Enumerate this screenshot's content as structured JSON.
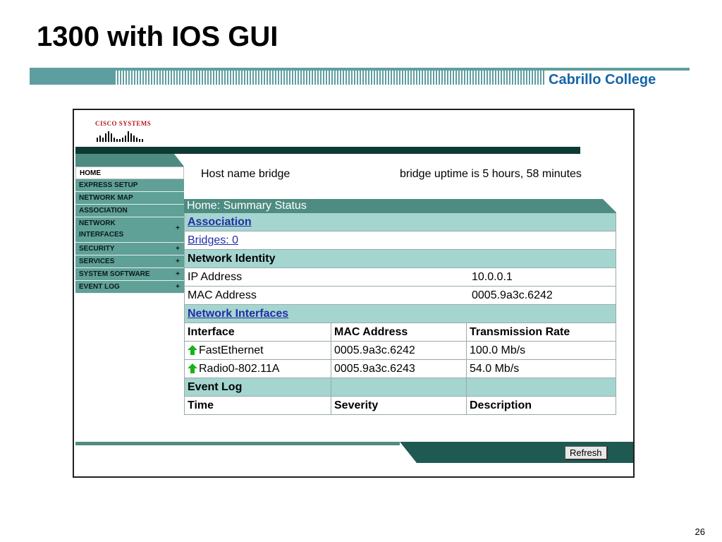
{
  "slide": {
    "title": "1300 with IOS GUI",
    "banner_text": "Cabrillo College",
    "page_number": "26"
  },
  "logo": {
    "text": "Cisco Systems"
  },
  "sidebar": {
    "items": [
      {
        "label": "HOME",
        "plus": ""
      },
      {
        "label": "EXPRESS SETUP",
        "plus": ""
      },
      {
        "label": "NETWORK MAP",
        "plus": ""
      },
      {
        "label": "ASSOCIATION",
        "plus": ""
      },
      {
        "label": "NETWORK",
        "label2": "INTERFACES",
        "plus": "+"
      },
      {
        "label": "SECURITY",
        "plus": "+"
      },
      {
        "label": "SERVICES",
        "plus": "+"
      },
      {
        "label": "SYSTEM SOFTWARE",
        "plus": "+"
      },
      {
        "label": "EVENT LOG",
        "plus": "+"
      }
    ]
  },
  "header": {
    "hostname": "Host name bridge",
    "uptime": "bridge uptime is 5 hours, 58 minutes"
  },
  "summary": {
    "title": "Home: Summary Status",
    "association_label": "Association",
    "bridges_link": "Bridges: 0",
    "network_identity_label": "Network Identity",
    "ip_label": "IP Address",
    "ip_value": "10.0.0.1",
    "mac_label": "MAC Address",
    "mac_value": "0005.9a3c.6242",
    "network_interfaces_label": "Network Interfaces",
    "interfaces_headers": [
      "Interface",
      "MAC Address",
      "Transmission Rate"
    ],
    "interfaces": [
      {
        "name": "FastEthernet",
        "mac": "0005.9a3c.6242",
        "rate": "100.0 Mb/s",
        "status_icon": "up-arrow-icon"
      },
      {
        "name": "Radio0-802.11A",
        "mac": "0005.9a3c.6243",
        "rate": "54.0 Mb/s",
        "status_icon": "up-arrow-icon"
      }
    ],
    "event_log_label": "Event Log",
    "event_headers": [
      "Time",
      "Severity",
      "Description"
    ]
  },
  "buttons": {
    "refresh": "Refresh"
  },
  "colors": {
    "nav_bg": "#5fa097",
    "section_bg": "#a5d5cf",
    "header_bar": "#4e8c82",
    "dark_bar": "#0e3a34",
    "link": "#1f2fa6",
    "brand_red": "#b41820",
    "banner_blue": "#1565a8"
  }
}
